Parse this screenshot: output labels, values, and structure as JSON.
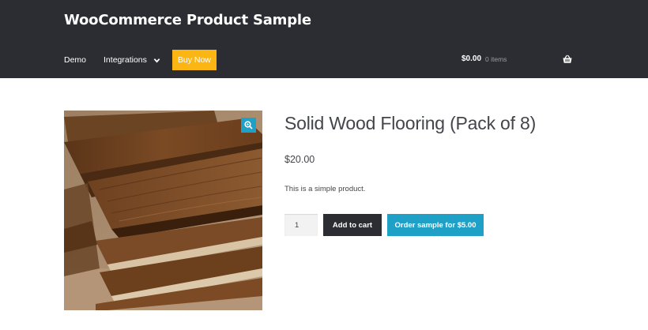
{
  "header": {
    "site_title": "WooCommerce Product Sample",
    "nav": [
      {
        "label": "Demo"
      },
      {
        "label": "Integrations"
      },
      {
        "label": "Buy Now"
      }
    ],
    "cart": {
      "total": "$0.00",
      "count": "0 items"
    }
  },
  "product": {
    "title": "Solid Wood Flooring (Pack of 8)",
    "price": "$20.00",
    "description": "This is a simple product.",
    "quantity": "1",
    "add_to_cart_label": "Add to cart",
    "order_sample_label": "Order sample for $5.00"
  },
  "colors": {
    "header_bg": "#2c2d33",
    "buy_now": "#fcb614",
    "accent": "#1ea0c7",
    "dark_button": "#2c2d33"
  },
  "icons": {
    "dropdown": "chevron-down-icon",
    "cart": "basket-icon",
    "zoom": "zoom-in-icon"
  }
}
